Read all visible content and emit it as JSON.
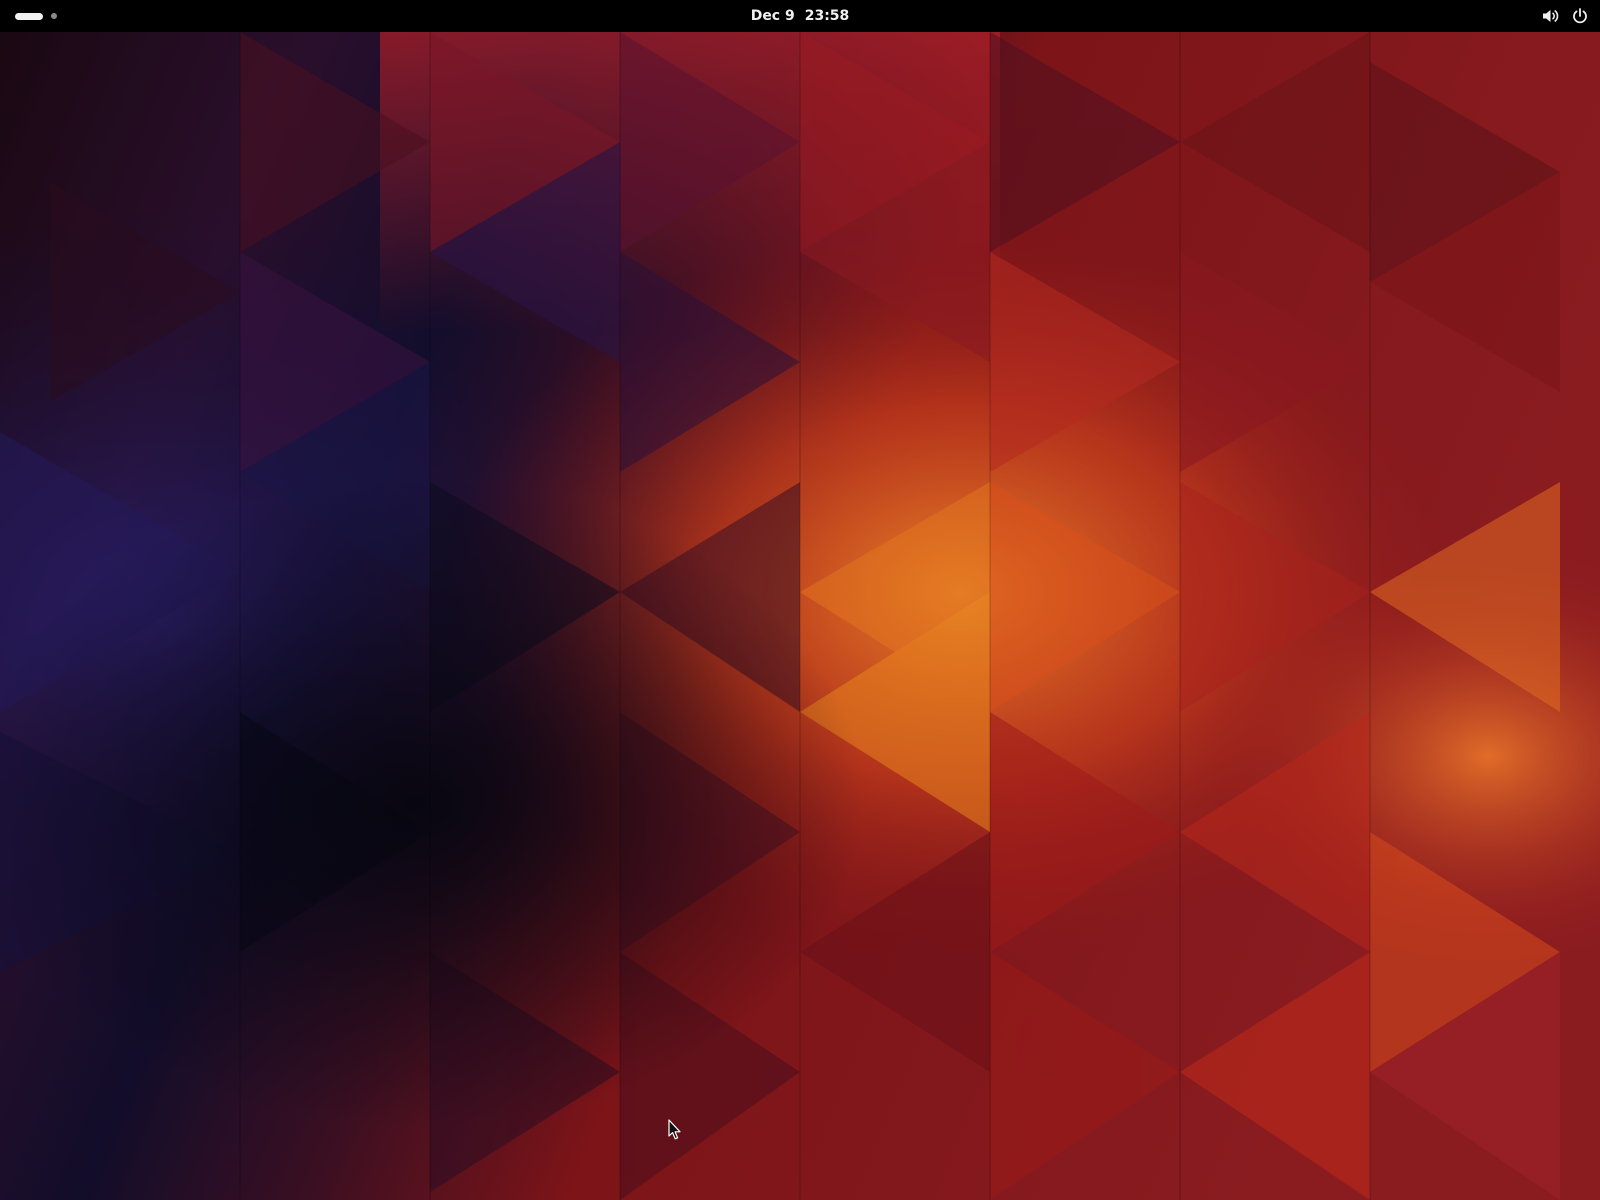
{
  "desktop": {
    "environment": "GNOME",
    "wallpaper": "geometric-triangles",
    "colors": {
      "panel_background": "#000000",
      "panel_text": "#f0f0f0",
      "wallpaper_dark": "#0b0a1c",
      "wallpaper_blue": "#221955",
      "wallpaper_red": "#8e1418",
      "wallpaper_orange": "#e8691f"
    }
  },
  "top_bar": {
    "activities": {
      "icon": "workspace-indicator-icon",
      "workspaces_count": 2,
      "active_workspace": 1
    },
    "clock": {
      "date": "Dec 9",
      "time": "23:58"
    },
    "status_icons": [
      "volume-icon",
      "power-icon"
    ]
  }
}
